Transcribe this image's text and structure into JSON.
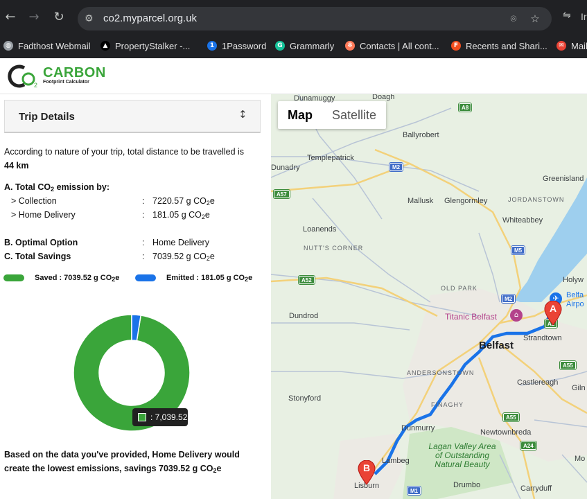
{
  "browser": {
    "url": "co2.myparcel.org.uk",
    "bookmarks": [
      {
        "label": "Fadthost Webmail",
        "icon": "globe-icon",
        "color": "#9aa0a6"
      },
      {
        "label": "PropertyStalker -...",
        "icon": "triangle-logo-icon",
        "color": "#ffffff"
      },
      {
        "label": "1Password",
        "icon": "onepassword-icon",
        "color": "#1a73e8"
      },
      {
        "label": "Grammarly",
        "icon": "grammarly-icon",
        "color": "#15c39a"
      },
      {
        "label": "Contacts | All cont...",
        "icon": "hubspot-icon",
        "color": "#ff7a59"
      },
      {
        "label": "Recents and Shari...",
        "icon": "figma-icon",
        "color": "#f24e1e"
      },
      {
        "label": "Mail",
        "icon": "mail-icon",
        "color": "#ea4335"
      }
    ],
    "extension_text": "Ir"
  },
  "header": {
    "logo_title": "CARBON",
    "logo_sub": "Footprint Calculator"
  },
  "trip": {
    "title": "Trip Details",
    "intro": "According to nature of your trip, total distance to be travelled is",
    "distance": "44 km",
    "section_a_prefix": "A. Total CO",
    "section_a_sub": "2",
    "section_a_suffix": " emission by:",
    "collection_label": "> Collection",
    "collection_value": "7220.57 g CO",
    "delivery_label": "> Home Delivery",
    "delivery_value": "181.05 g CO",
    "unit_sub": "2",
    "unit_suffix": "e",
    "colon": ":",
    "optimal_label": "B. Optimal Option",
    "optimal_value": "Home Delivery",
    "savings_label": "C. Total Savings",
    "savings_value": "7039.52 g CO",
    "legend_saved": "Saved : 7039.52 g CO",
    "legend_emitted": "Emitted : 181.05 g CO",
    "summary_line1": "Based on the data you've provided, Home Delivery would",
    "summary_line2": "create the lowest emissions, savings 7039.52 g CO",
    "tooltip": ": 7,039.52"
  },
  "chart_data": {
    "type": "pie",
    "labels": [
      "Saved",
      "Emitted"
    ],
    "values": [
      7039.52,
      181.05
    ],
    "colors": [
      "#3aa53a",
      "#1a73e8"
    ],
    "donut": true
  },
  "map": {
    "type_map": "Map",
    "type_satellite": "Satellite",
    "labels": {
      "dunamuggy": "Dunamuggy",
      "doagh": "Doagh",
      "ballyrobert": "Ballyrobert",
      "templepatrick": "Templepatrick",
      "dunadry": "Dunadry",
      "greenisland": "Greenisland",
      "mallusk": "Mallusk",
      "glengormley": "Glengormley",
      "jordanstown": "JORDANSTOWN",
      "whiteabbey": "Whiteabbey",
      "loanends": "Loanends",
      "nutts": "NUTT'S CORNER",
      "holywood": "Holyw",
      "old_park": "OLD PARK",
      "belfast_airport": "Belfa Airpo",
      "titanic": "Titanic Belfast",
      "dundrod": "Dundrod",
      "belfast": "Belfast",
      "strandtown": "Strandtown",
      "andersonstown": "ANDERSONSTOWN",
      "castlereagh": "Castlereagh",
      "gilnahirk": "Giln",
      "stonyford": "Stonyford",
      "finaghy": "FINAGHY",
      "dunmurry": "Dunmurry",
      "newtownbreda": "Newtownbreda",
      "lagan": "Lagan Valley Area of Outstanding Natural Beauty",
      "lambeg": "Lambeg",
      "moneyreagh": "Mo",
      "lisburn": "Lisburn",
      "drumbo": "Drumbo",
      "carryduff": "Carryduff"
    },
    "roads": {
      "a8": "A8",
      "m2a": "M2",
      "a57": "A57",
      "m5": "M5",
      "a52": "A52",
      "m2b": "M2",
      "a2": "A2",
      "a55a": "A55",
      "a55b": "A55",
      "a24": "A24",
      "m1": "M1"
    },
    "pin_a": "A",
    "pin_b": "B"
  }
}
